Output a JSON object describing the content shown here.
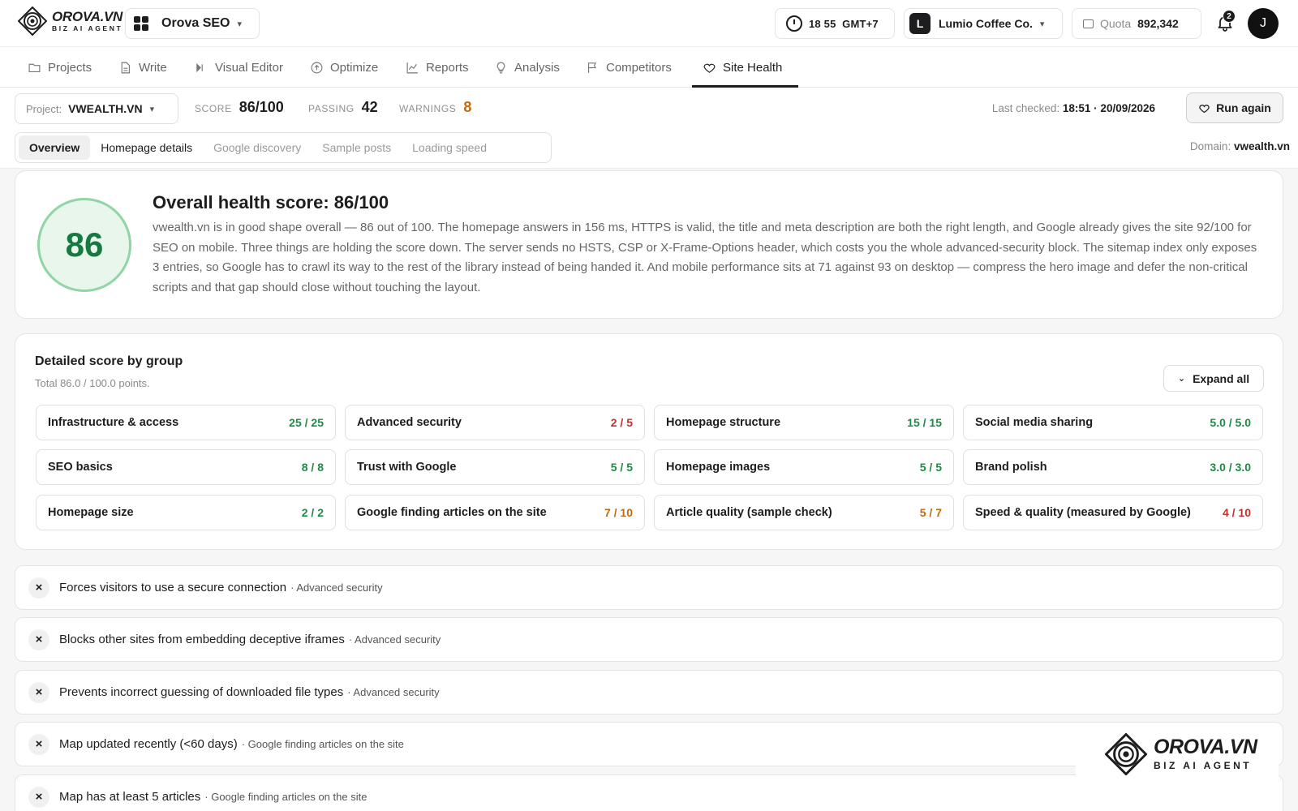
{
  "brand": {
    "name": "OROVA.VN",
    "tagline": "BIZ AI AGENT"
  },
  "app_switcher": {
    "label": "Orova SEO"
  },
  "clock": {
    "text": "18 55  GMT+7"
  },
  "org": {
    "initial": "L",
    "name": "Lumio Coffee Co."
  },
  "quota": {
    "label": "Quota",
    "value": "892,342"
  },
  "notifications": {
    "count": "2"
  },
  "user": {
    "initial": "J"
  },
  "nav": [
    {
      "label": "Projects",
      "icon": "folder-icon"
    },
    {
      "label": "Write",
      "icon": "document-icon"
    },
    {
      "label": "Visual Editor",
      "icon": "visual-editor-icon"
    },
    {
      "label": "Optimize",
      "icon": "arrow-up-circle-icon"
    },
    {
      "label": "Reports",
      "icon": "line-chart-icon"
    },
    {
      "label": "Analysis",
      "icon": "lightbulb-icon"
    },
    {
      "label": "Competitors",
      "icon": "flag-icon"
    },
    {
      "label": "Site Health",
      "icon": "heart-icon",
      "active": true
    }
  ],
  "project": {
    "label": "Project:",
    "value": "VWEALTH.VN"
  },
  "stats": {
    "score_label": "SCORE",
    "score_value": "86/100",
    "passing_label": "PASSING",
    "passing_value": "42",
    "warnings_label": "WARNINGS",
    "warnings_value": "8"
  },
  "last_checked": {
    "label": "Last checked:",
    "value": "18:51 · 20/09/2026"
  },
  "run_again": {
    "label": "Run again"
  },
  "subtabs": [
    "Overview",
    "Homepage details",
    "Google discovery",
    "Sample posts",
    "Loading speed"
  ],
  "domain": {
    "label": "Domain:",
    "value": "vwealth.vn"
  },
  "health": {
    "score": "86",
    "title": "Overall health score: 86/100",
    "description": "vwealth.vn is in good shape overall — 86 out of 100. The homepage answers in 156 ms, HTTPS is valid, the title and meta description are both the right length, and Google already gives the site 92/100 for SEO on mobile. Three things are holding the score down. The server sends no HSTS, CSP or X-Frame-Options header, which costs you the whole advanced-security block. The sitemap index only exposes 3 entries, so Google has to crawl its way to the rest of the library instead of being handed it. And mobile performance sits at 71 against 93 on desktop — compress the hero image and defer the non-critical scripts and that gap should close without touching the layout."
  },
  "groups": {
    "title": "Detailed score by group",
    "subtitle": "Total 86.0 / 100.0 points.",
    "expand_label": "Expand all",
    "items": [
      {
        "name": "Infrastructure & access",
        "score": "25 / 25",
        "status": "good"
      },
      {
        "name": "Advanced security",
        "score": "2 / 5",
        "status": "bad"
      },
      {
        "name": "Homepage structure",
        "score": "15 / 15",
        "status": "good"
      },
      {
        "name": "Social media sharing",
        "score": "5.0 / 5.0",
        "status": "good"
      },
      {
        "name": "SEO basics",
        "score": "8 / 8",
        "status": "good"
      },
      {
        "name": "Trust with Google",
        "score": "5 / 5",
        "status": "good"
      },
      {
        "name": "Homepage images",
        "score": "5 / 5",
        "status": "good"
      },
      {
        "name": "Brand polish",
        "score": "3.0 / 3.0",
        "status": "good"
      },
      {
        "name": "Homepage size",
        "score": "2 / 2",
        "status": "good"
      },
      {
        "name": "Google finding articles on the site",
        "score": "7 / 10",
        "status": "mid"
      },
      {
        "name": "Article quality (sample check)",
        "score": "5 / 7",
        "status": "mid"
      },
      {
        "name": "Speed & quality (measured by Google)",
        "score": "4 / 10",
        "status": "bad"
      }
    ]
  },
  "issues": [
    {
      "text": "Forces visitors to use a secure connection",
      "group": "· Advanced security"
    },
    {
      "text": "Blocks other sites from embedding deceptive iframes",
      "group": "· Advanced security"
    },
    {
      "text": "Prevents incorrect guessing of downloaded file types",
      "group": "· Advanced security"
    },
    {
      "text": "Map updated recently (<60 days)",
      "group": "· Google finding articles on the site"
    },
    {
      "text": "Map has at least 5 articles",
      "group": "· Google finding articles on the site"
    }
  ],
  "colors": {
    "good": "#1f8a47",
    "mid": "#c06a12",
    "bad": "#c2302e",
    "score_ring": "#8fd5a6"
  }
}
